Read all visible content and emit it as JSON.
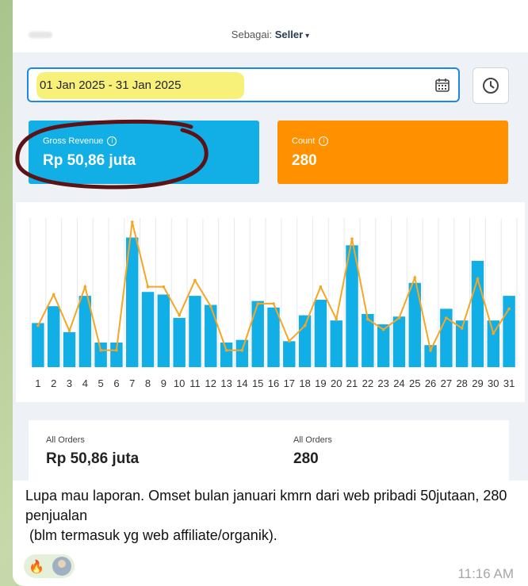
{
  "role_selector": {
    "prefix": "Sebagai:",
    "value": "Seller"
  },
  "date_range": {
    "value": "01 Jan 2025 - 31 Jan 2025"
  },
  "cards": [
    {
      "label": "Gross Revenue",
      "value": "Rp 50,86 juta",
      "color": "#12aee6"
    },
    {
      "label": "Count",
      "value": "280",
      "color": "#ff9100"
    }
  ],
  "orders": [
    {
      "label": "All Orders",
      "value": "Rp 50,86 juta"
    },
    {
      "label": "All Orders",
      "value": "280"
    }
  ],
  "message": {
    "text": "Lupa mau laporan. Omset bulan januari kmrn dari web pribadi 50jutaan, 280 penjualan\n (blm termasuk yg web affiliate/organik).",
    "time": "11:16 AM",
    "reaction_emoji": "🔥"
  },
  "chart_data": {
    "type": "bar",
    "categories": [
      "1",
      "2",
      "3",
      "4",
      "5",
      "6",
      "7",
      "8",
      "9",
      "10",
      "11",
      "12",
      "13",
      "14",
      "15",
      "16",
      "17",
      "18",
      "19",
      "20",
      "21",
      "22",
      "23",
      "24",
      "25",
      "26",
      "27",
      "28",
      "29",
      "30",
      "31"
    ],
    "series": [
      {
        "type": "bar",
        "color": "#12aee6",
        "values": [
          34,
          47,
          27,
          55,
          19,
          19,
          100,
          58,
          56,
          38,
          55,
          48,
          19,
          21,
          51,
          46,
          20,
          40,
          52,
          36,
          94,
          41,
          33,
          39,
          65,
          17,
          45,
          36,
          82,
          36,
          55
        ]
      },
      {
        "type": "line",
        "color": "#f5a623",
        "values": [
          32,
          56,
          28,
          62,
          13,
          13,
          112,
          62,
          62,
          40,
          67,
          47,
          13,
          13,
          49,
          49,
          20,
          32,
          62,
          37,
          99,
          37,
          29,
          38,
          69,
          13,
          38,
          30,
          68,
          26,
          45
        ]
      }
    ],
    "ylim": [
      0,
      115
    ],
    "grid": true
  }
}
